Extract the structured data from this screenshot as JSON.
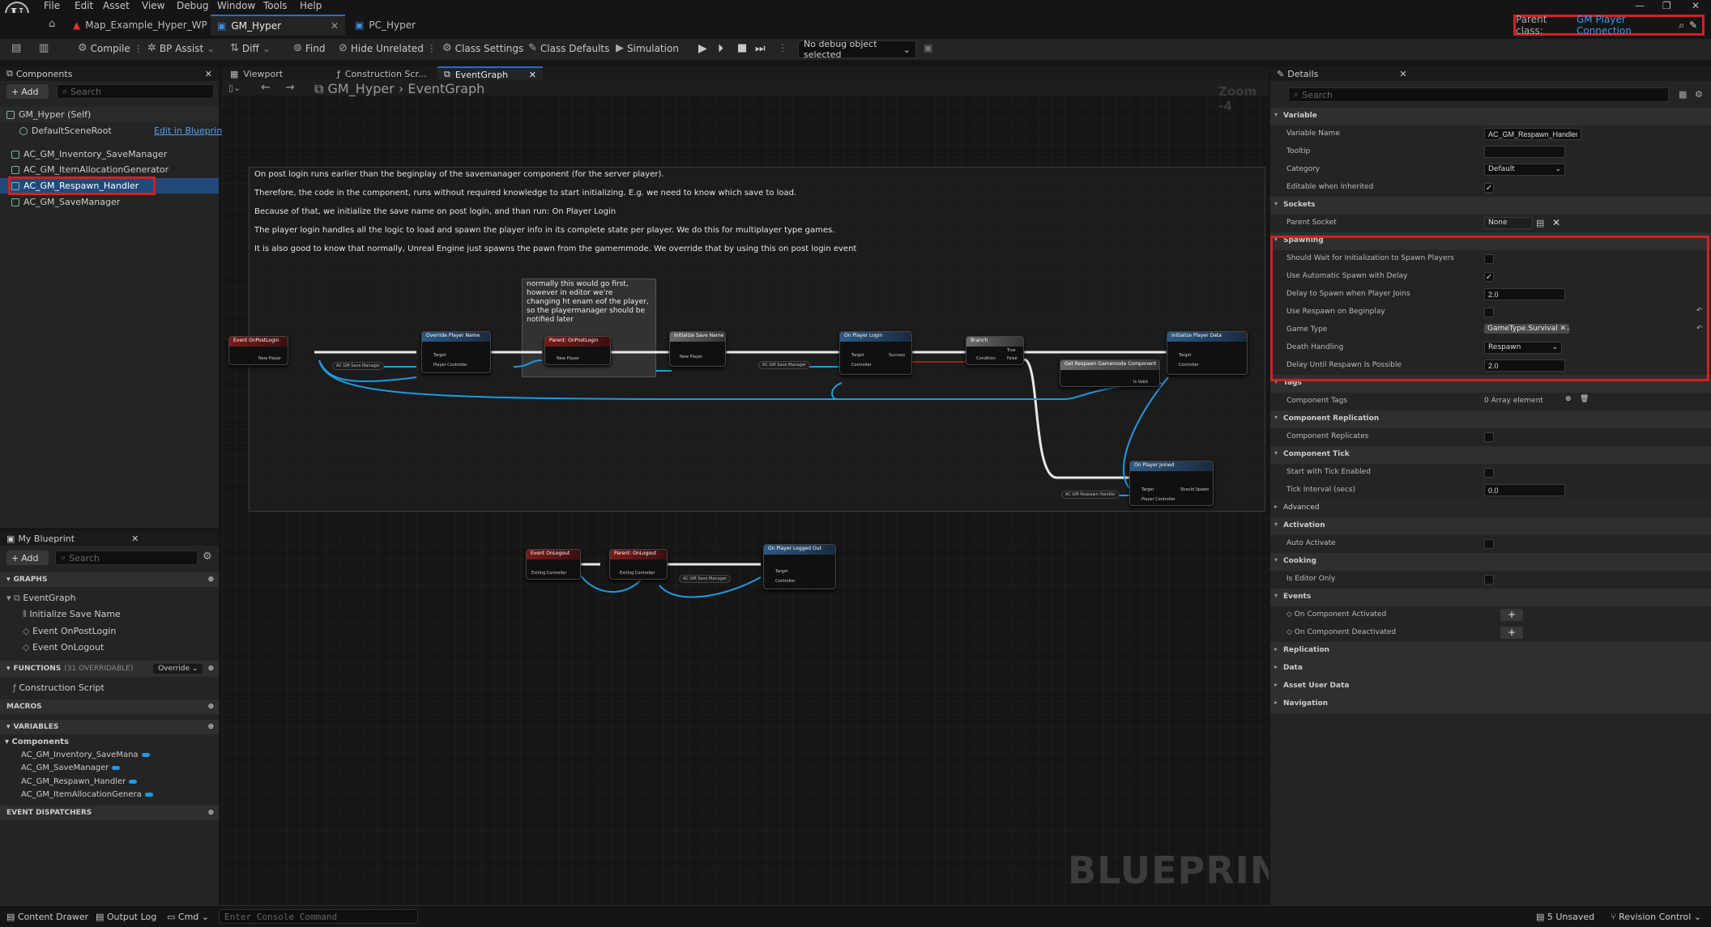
{
  "menu": [
    "File",
    "Edit",
    "Asset",
    "View",
    "Debug",
    "Window",
    "Tools",
    "Help"
  ],
  "tabs": [
    {
      "label": "Map_Example_Hyper_WP",
      "active": false
    },
    {
      "label": "GM_Hyper",
      "active": true
    },
    {
      "label": "PC_Hyper",
      "active": false
    }
  ],
  "parent_class": {
    "label": "Parent class:",
    "value": "GM Player Connection"
  },
  "toolbar": {
    "compile": "Compile",
    "bp_assist": "BP Assist",
    "diff": "Diff",
    "find": "Find",
    "hide_unrelated": "Hide Unrelated",
    "class_settings": "Class Settings",
    "class_defaults": "Class Defaults",
    "simulation": "Simulation",
    "debug_object": "No debug object selected"
  },
  "components_panel": {
    "title": "Components",
    "add": "Add",
    "search_placeholder": "Search",
    "root": "GM_Hyper (Self)",
    "scene_root": "DefaultSceneRoot",
    "edit_link": "Edit in Blueprint",
    "items": [
      "AC_GM_Inventory_SaveManager",
      "AC_GM_ItemAllocationGenerator",
      "AC_GM_Respawn_Handler",
      "AC_GM_SaveManager"
    ],
    "selected_index": 2
  },
  "graph_tabs": [
    "Viewport",
    "Construction Scr...",
    "EventGraph"
  ],
  "graph": {
    "breadcrumb_root": "GM_Hyper",
    "breadcrumb_leaf": "EventGraph",
    "zoom": "Zoom -4",
    "watermark": "BLUEPRINT",
    "comment_lines": [
      "On post login runs earlier than the beginplay of the savemanager component (for the server player).",
      "Therefore, the code in the component, runs without required knowledge to start initializing. E.g. we need to know which save to load.",
      "Because of that, we initialize the save name on post login, and than run: On Player Login",
      "The player login handles all the logic to load and spawn the player info in its complete state per player. We do this for multiplayer type games.",
      "It is also good to know that normally, Unreal Engine just spawns the pawn from the gamemmode. We override that by using this on post login event"
    ],
    "note_lines": [
      "normally this would go first,",
      "however in editor we're",
      "changing ht enam eof the player,",
      "so the playermanager should be",
      "notified later"
    ],
    "nodes": {
      "event_postlogin": "Event OnPostLogin",
      "override_player_name": "Override Player Name",
      "parent_postlogin": "Parent: OnPostLogin",
      "initialize_save_name": "Initialize Save Name",
      "on_player_login": "On Player Login",
      "branch": "Branch",
      "get_respawn": "Get Respawn Gamemode Component",
      "initialize_player_data": "Initialize Player Data",
      "on_player_joined": "On Player Joined",
      "event_onlogout": "Event OnLogout",
      "parent_onlogout": "Parent: OnLogout",
      "on_player_logged_out": "On Player Logged Out",
      "ac_save_manager": "AC GM Save Manager",
      "ac_respawn_handler": "AC GM Respawn Handler",
      "new_player": "New Player",
      "target": "Target",
      "player_controller": "Player Controller",
      "exiting_controller": "Exiting Controller",
      "success": "Success",
      "true": "True",
      "false": "False",
      "is_valid": "Is Valid",
      "should_spawn": "Should Spawn",
      "controller": "Controller"
    }
  },
  "my_blueprint": {
    "title": "My Blueprint",
    "add": "Add",
    "search_placeholder": "Search",
    "graphs_label": "GRAPHS",
    "event_graph": "EventGraph",
    "graph_items": [
      "Initialize Save Name",
      "Event OnPostLogin",
      "Event OnLogout"
    ],
    "functions_label": "FUNCTIONS",
    "functions_count": "(31 OVERRIDABLE)",
    "override": "Override",
    "construction_script": "Construction Script",
    "macros_label": "MACROS",
    "variables_label": "VARIABLES",
    "components_label": "Components",
    "variables": [
      "AC_GM_Inventory_SaveMana",
      "AC_GM_SaveManager",
      "AC_GM_Respawn_Handler",
      "AC_GM_ItemAllocationGenera"
    ],
    "event_dispatchers": "EVENT DISPATCHERS"
  },
  "details": {
    "title": "Details",
    "search_placeholder": "Search",
    "sections": {
      "variable": "Variable",
      "sockets": "Sockets",
      "spawning": "Spawning",
      "tags": "Tags",
      "component_replication": "Component Replication",
      "component_tick": "Component Tick",
      "advanced": "Advanced",
      "activation": "Activation",
      "cooking": "Cooking",
      "events": "Events",
      "replication": "Replication",
      "data": "Data",
      "asset_user_data": "Asset User Data",
      "navigation": "Navigation"
    },
    "variable_name_label": "Variable Name",
    "variable_name": "AC_GM_Respawn_Handler",
    "tooltip_label": "Tooltip",
    "tooltip": "",
    "category_label": "Category",
    "category": "Default",
    "editable_label": "Editable when Inherited",
    "editable": true,
    "parent_socket_label": "Parent Socket",
    "parent_socket": "None",
    "spawning": {
      "wait_label": "Should Wait for Initialization to Spawn Players",
      "wait": false,
      "auto_label": "Use Automatic Spawn with Delay",
      "auto": true,
      "delay_label": "Delay to Spawn when Player Joins",
      "delay": "2.0",
      "respawn_begin_label": "Use Respawn on Beginplay",
      "respawn_begin": false,
      "game_type_label": "Game Type",
      "game_type": "GameType.Survival",
      "death_label": "Death Handling",
      "death": "Respawn",
      "delay_until_label": "Delay Until Respawn Is Possible",
      "delay_until": "2.0"
    },
    "component_tags_label": "Component Tags",
    "component_tags": "0 Array element",
    "replicates_label": "Component Replicates",
    "tick_enabled_label": "Start with Tick Enabled",
    "tick_interval_label": "Tick Interval (secs)",
    "tick_interval": "0.0",
    "auto_activate_label": "Auto Activate",
    "editor_only_label": "Is Editor Only",
    "on_activated": "On Component Activated",
    "on_deactivated": "On Component Deactivated"
  },
  "statusbar": {
    "content_drawer": "Content Drawer",
    "output_log": "Output Log",
    "cmd": "Cmd",
    "console_placeholder": "Enter Console Command",
    "unsaved": "5 Unsaved",
    "revision": "Revision Control"
  },
  "colors": {
    "accent": "#2a6cc4",
    "highlight": "#d42020",
    "selection": "#23497a",
    "wire_exec": "#e8e8e8",
    "wire_object": "#1f9ae0"
  }
}
